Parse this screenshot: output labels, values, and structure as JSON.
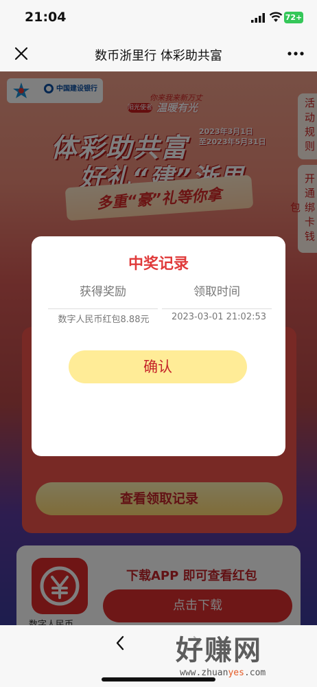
{
  "status_bar": {
    "time": "21:04",
    "battery": "72+"
  },
  "nav": {
    "title": "数币浙里行 体彩助共富"
  },
  "banner": {
    "bank_name": "中国建设银行",
    "subtitle_top": "你来我来新万丈",
    "subtitle_pill": "阳光使者",
    "subtitle_main": "温暖有光",
    "headline_1": "体彩助共富",
    "headline_2": "好礼“建”浙里",
    "date_start": "2023年3月1日",
    "date_end": "至2023年5月31日",
    "ribbon": "多重“豪”礼等你拿"
  },
  "side_tabs": {
    "rules": "活动规则",
    "wallet": "开通绑卡钱包"
  },
  "page": {
    "record_button": "查看领取记录",
    "download_text": "下载APP 即可查看红包",
    "download_button": "点击下载",
    "app_name": "数字人民币"
  },
  "modal": {
    "title": "中奖记录",
    "col_prize": "获得奖励",
    "col_time": "领取时间",
    "rows": [
      {
        "prize": "数字人民币红包8.88元",
        "time": "2023-03-01 21:02:53"
      }
    ],
    "confirm": "确认"
  },
  "watermark": {
    "main": "好赚网",
    "sub_1": "www.zhuan",
    "sub_2": "yes",
    "sub_3": ".com"
  },
  "colors": {
    "accent_red": "#e03a3a",
    "button_yellow": "#ffec97",
    "battery_green": "#35c759"
  }
}
